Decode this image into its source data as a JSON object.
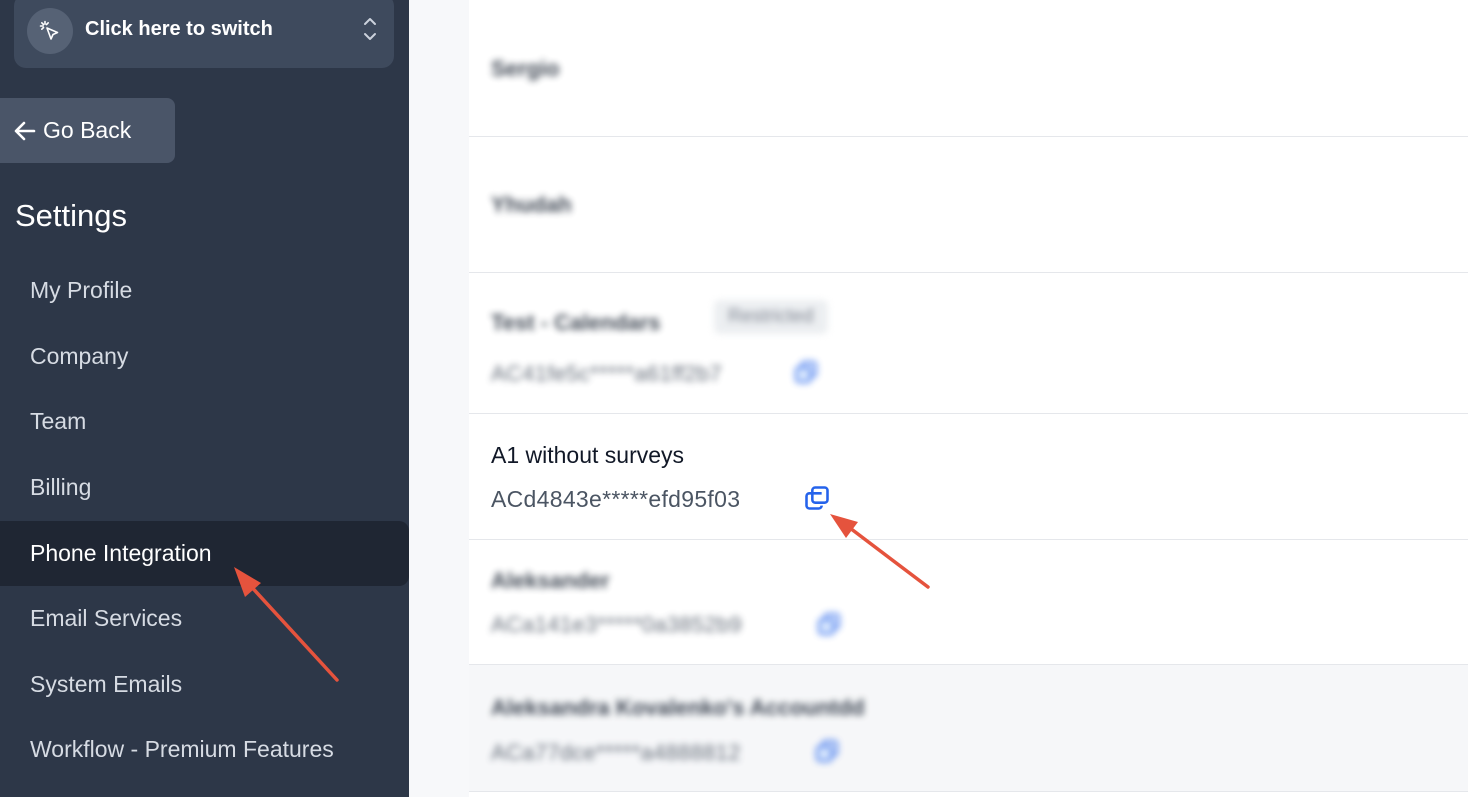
{
  "sidebar": {
    "switcher_label": "Click here to switch",
    "go_back_label": "Go Back",
    "settings_title": "Settings",
    "items": [
      {
        "label": "My Profile"
      },
      {
        "label": "Company"
      },
      {
        "label": "Team"
      },
      {
        "label": "Billing"
      },
      {
        "label": "Phone Integration",
        "active": true
      },
      {
        "label": "Email Services"
      },
      {
        "label": "System Emails"
      },
      {
        "label": "Workflow - Premium Features"
      }
    ]
  },
  "accounts": [
    {
      "name": "Sergio",
      "sid": ""
    },
    {
      "name": "Yhudah",
      "sid": ""
    },
    {
      "name": "Test - Calendars",
      "badge": "Restricted",
      "sid": "AC41fe5c*****a61ff2b7"
    },
    {
      "name": "A1 without surveys",
      "sid": "ACd4843e*****efd95f03"
    },
    {
      "name": "Aleksander",
      "sid": "ACa141e3*****0a3852b9"
    },
    {
      "name": "Aleksandra Kovalenko's Accountdd",
      "sid": "ACa77dce*****a4888812"
    }
  ],
  "colors": {
    "sidebar_bg": "#2d3748",
    "active_item_bg": "#1f2633",
    "copy_icon": "#2563eb",
    "annotation_arrow": "#e5533d"
  }
}
